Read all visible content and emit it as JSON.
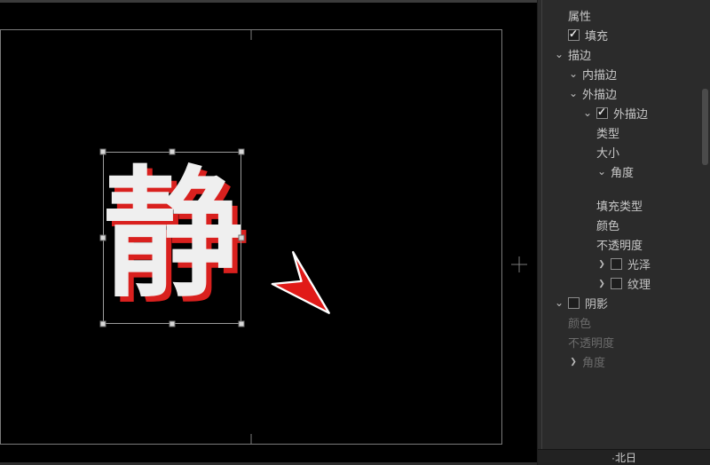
{
  "canvas": {
    "text_content": "静"
  },
  "panel": {
    "properties": "属性",
    "fill": "填充",
    "stroke": "描边",
    "inner_stroke": "内描边",
    "outer_stroke_group": "外描边",
    "outer_stroke_item": "外描边",
    "type": "类型",
    "size": "大小",
    "angle": "角度",
    "fill_type": "填充类型",
    "color": "颜色",
    "opacity": "不透明度",
    "gloss": "光泽",
    "texture": "纹理",
    "shadow": "阴影",
    "shadow_color": "颜色",
    "shadow_opacity": "不透明度",
    "shadow_angle": "角度",
    "footer": "·北日"
  }
}
